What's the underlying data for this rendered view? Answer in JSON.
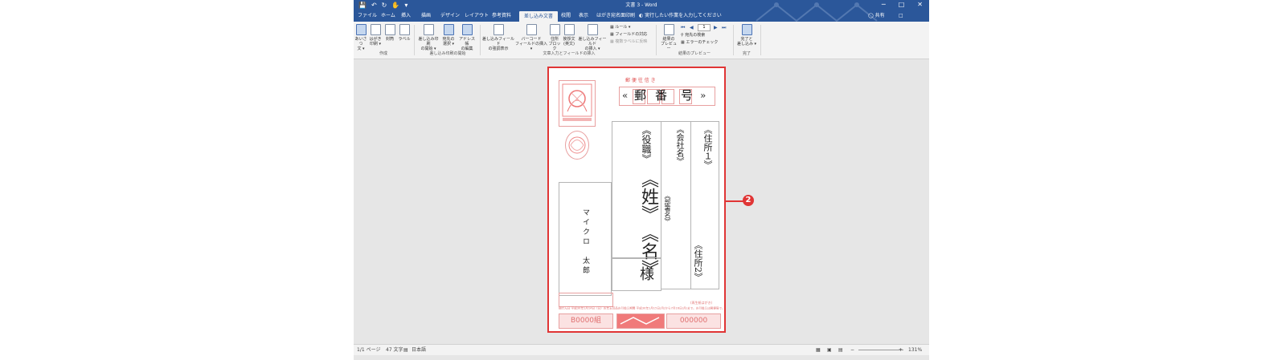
{
  "window": {
    "title": "文書 3 - Word",
    "qa_icons": [
      "save-icon",
      "undo-icon",
      "redo-icon",
      "touch-icon",
      "customize-icon"
    ],
    "controls": [
      "─",
      "□",
      "✕"
    ]
  },
  "tabs": [
    "ファイル",
    "ホーム",
    "挿入",
    "描画",
    "デザイン",
    "レイアウト",
    "参考資料",
    "差し込み文書",
    "校閲",
    "表示",
    "はがき宛名面印刷"
  ],
  "active_tab": "差し込み文書",
  "tellme": "実行したい作業を入力してください",
  "share": "共有",
  "ribbon": {
    "create": {
      "label": "作成",
      "buttons": [
        {
          "l1": "あいさつ",
          "l2": "文 ▾"
        },
        {
          "l1": "はがき",
          "l2": "印刷 ▾"
        },
        {
          "l1": "封筒",
          "l2": ""
        },
        {
          "l1": "ラベル",
          "l2": ""
        }
      ]
    },
    "start": {
      "label": "差し込み印刷の開始",
      "buttons": [
        {
          "l1": "差し込み印刷",
          "l2": "の開始 ▾"
        },
        {
          "l1": "宛先の",
          "l2": "選択 ▾"
        },
        {
          "l1": "アドレス帳",
          "l2": "の編集"
        }
      ]
    },
    "insert": {
      "label": "文章入力とフィールドの挿入",
      "buttons": [
        {
          "l1": "差し込みフィールド",
          "l2": "の強調表示"
        },
        {
          "l1": "バーコード",
          "l2": "フィールドの挿入 ▾"
        },
        {
          "l1": "住所",
          "l2": "ブロック"
        },
        {
          "l1": "挨拶文",
          "l2": "(英文)"
        },
        {
          "l1": "差し込みフィールド",
          "l2": "の挿入 ▾"
        }
      ],
      "small": [
        "ルール ▾",
        "フィールドの対応",
        "複数ラベルに反映"
      ]
    },
    "preview": {
      "label": "結果のプレビュー",
      "button": {
        "l1": "結果の",
        "l2": "プレビュー"
      },
      "record": "1",
      "small": [
        "宛先の検索",
        "エラーのチェック"
      ]
    },
    "finish": {
      "label": "完了",
      "button": {
        "l1": "完了と",
        "l2": "差し込み ▾"
      }
    }
  },
  "postcard": {
    "zip_label": "郵 便 往 信 き",
    "zip_chars": [
      "«",
      "郵",
      "番",
      "号",
      "»"
    ],
    "title_field": "《役職》",
    "last_name": "《姓》",
    "first_name": "《名》",
    "honorific": "様",
    "company": "《会社名》",
    "dept": "《部署名》",
    "addr1": "《住所１》",
    "addr2": "《住所2》",
    "sender": "マイクロ　太郎",
    "lottery_left": "B0000組",
    "lottery_right": "000000",
    "footer_small": "(再生紙はがき)",
    "footer_line": "抽せん日 平成30年1月14日（日）お年玉賞品お引換え期間 平成30年1月15日(月)から7月16日(月)まで。お引換えは郵便局で。"
  },
  "callout_number": "2",
  "status": {
    "pages": "1/1 ページ",
    "words": "47 文字",
    "lang": "日本語",
    "zoom": "131%"
  }
}
